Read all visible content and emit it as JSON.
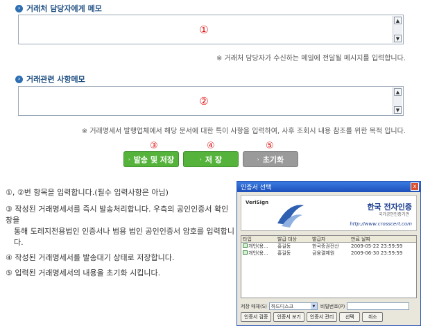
{
  "section1": {
    "title": "거래처 담당자에게 메모",
    "number": "①",
    "hint": "※ 거래처 담당자가 수신하는 메일에 전달될 메시지를 입력합니다."
  },
  "section2": {
    "title": "거래관련 사항메모",
    "number": "②",
    "hint": "※ 거래명세서 발행업체에서 해당 문서에 대한 특이 사항을 입력하여, 사후 조회시 내용 참조를 위한 목적 입니다."
  },
  "buttons": [
    {
      "num": "③",
      "label": "발송 및 저장",
      "style": "green"
    },
    {
      "num": "④",
      "label": "저 장",
      "style": "green"
    },
    {
      "num": "⑤",
      "label": "초기화",
      "style": "gray"
    }
  ],
  "notes": [
    "①, ②번 항목을 입력합니다.(필수 입력사항은 아님)",
    "③ 작성된 거래명세서를 즉시 발송처리합니다. 우측의 공인인증서 확인창을",
    "통해 도레지전용법인 인증서나 범용 법인 공인인증서 암호를 입력합니다.",
    "④ 작성된 거래명세서를 발송대기 상태로 저장합니다.",
    "⑤ 입력된 거래명세서의 내용을 초기화 시킵니다."
  ],
  "dialog": {
    "title": "인증서 선택",
    "close_glyph": "x",
    "verisign": "VeriSign",
    "brand": "한국 전자인증",
    "brand_sub": "국가공인인증기관",
    "url": "http://www.crosscert.com",
    "columns": [
      "타입",
      "발급 대상",
      "발급자",
      "만료 날짜"
    ],
    "rows": [
      [
        "개인(용...",
        "홍길동",
        "한국증권전산",
        "2009-05-22 23:59:59"
      ],
      [
        "개인(용...",
        "홍길동",
        "금융결제원",
        "2009-06-30 23:59:59"
      ]
    ],
    "storage_label": "저장 매체(S)",
    "storage_value": "하드디스크",
    "password_label": "비밀번호(P)",
    "btn_verify": "인증서 검증",
    "btn_view": "인증서 보기",
    "btn_manage": "인증서 관리",
    "btn_select": "선택",
    "btn_cancel": "취소"
  },
  "colors": {
    "accent_blue": "#1f4f82",
    "number_red": "#e01010",
    "button_green": "#55b33c",
    "button_gray": "#9a9a9a"
  }
}
